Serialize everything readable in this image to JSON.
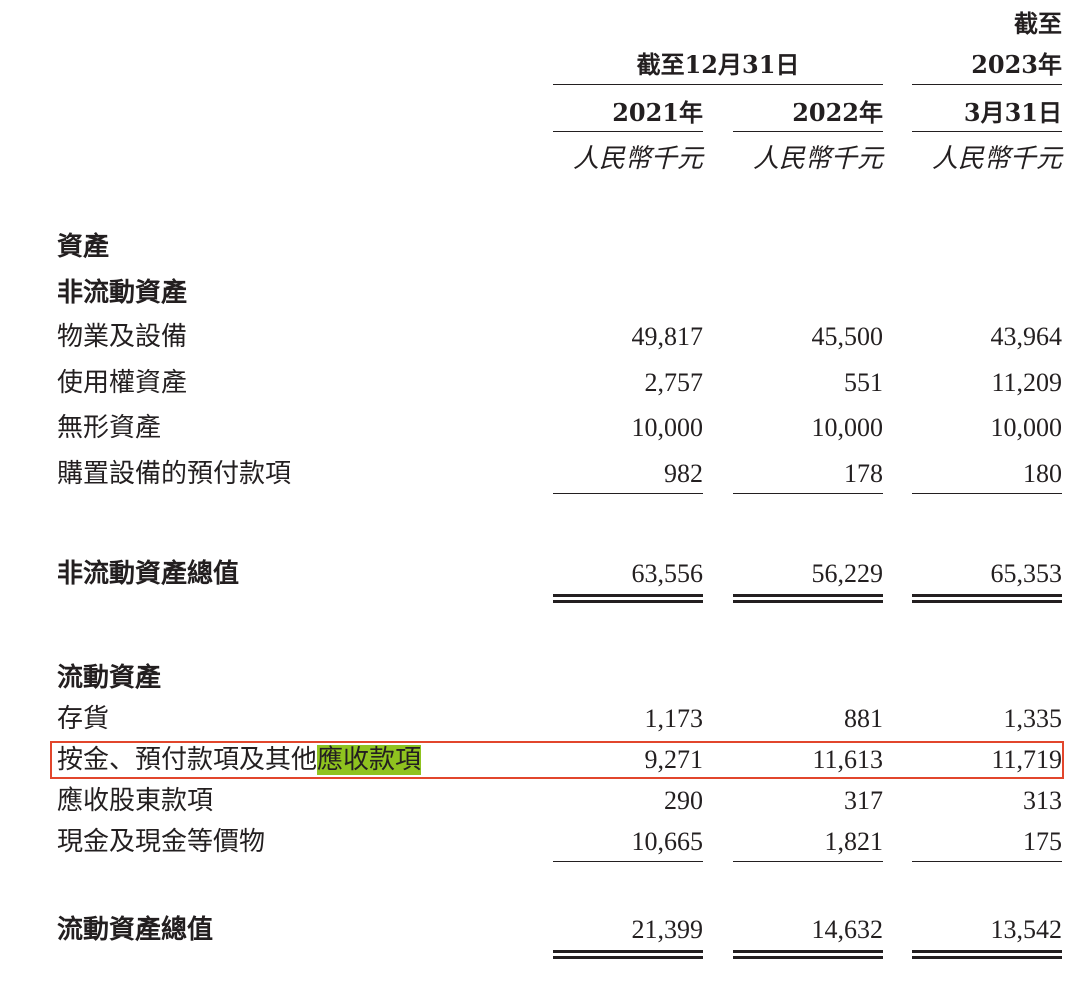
{
  "header": {
    "col3_line1": "截至",
    "col3_line2": "2023年",
    "col3_line3": "3月31日",
    "group_label": "截至12月31日",
    "col1_year": "2021年",
    "col2_year": "2022年",
    "unit": "人民幣千元"
  },
  "sections": {
    "assets": "資產",
    "non_current": "非流動資產",
    "current": "流動資產"
  },
  "non_current_rows": [
    {
      "label": "物業及設備",
      "v": [
        "49,817",
        "45,500",
        "43,964"
      ]
    },
    {
      "label": "使用權資產",
      "v": [
        "2,757",
        "551",
        "11,209"
      ]
    },
    {
      "label": "無形資產",
      "v": [
        "10,000",
        "10,000",
        "10,000"
      ]
    },
    {
      "label": "購置設備的預付款項",
      "v": [
        "982",
        "178",
        "180"
      ]
    }
  ],
  "non_current_total": {
    "label": "非流動資產總值",
    "v": [
      "63,556",
      "56,229",
      "65,353"
    ]
  },
  "current_rows": [
    {
      "label": "存貨",
      "v": [
        "1,173",
        "881",
        "1,335"
      ]
    },
    {
      "label_plain": "按金、預付款項及其他",
      "label_highlight": "應收款項",
      "v": [
        "9,271",
        "11,613",
        "11,719"
      ]
    },
    {
      "label": "應收股東款項",
      "v": [
        "290",
        "317",
        "313"
      ]
    },
    {
      "label": "現金及現金等價物",
      "v": [
        "10,665",
        "1,821",
        "175"
      ]
    }
  ],
  "current_total": {
    "label": "流動資產總值",
    "v": [
      "21,399",
      "14,632",
      "13,542"
    ]
  },
  "colors": {
    "text": "#231f20",
    "highlight": "#8fc31f",
    "box_border": "#e2462c"
  }
}
